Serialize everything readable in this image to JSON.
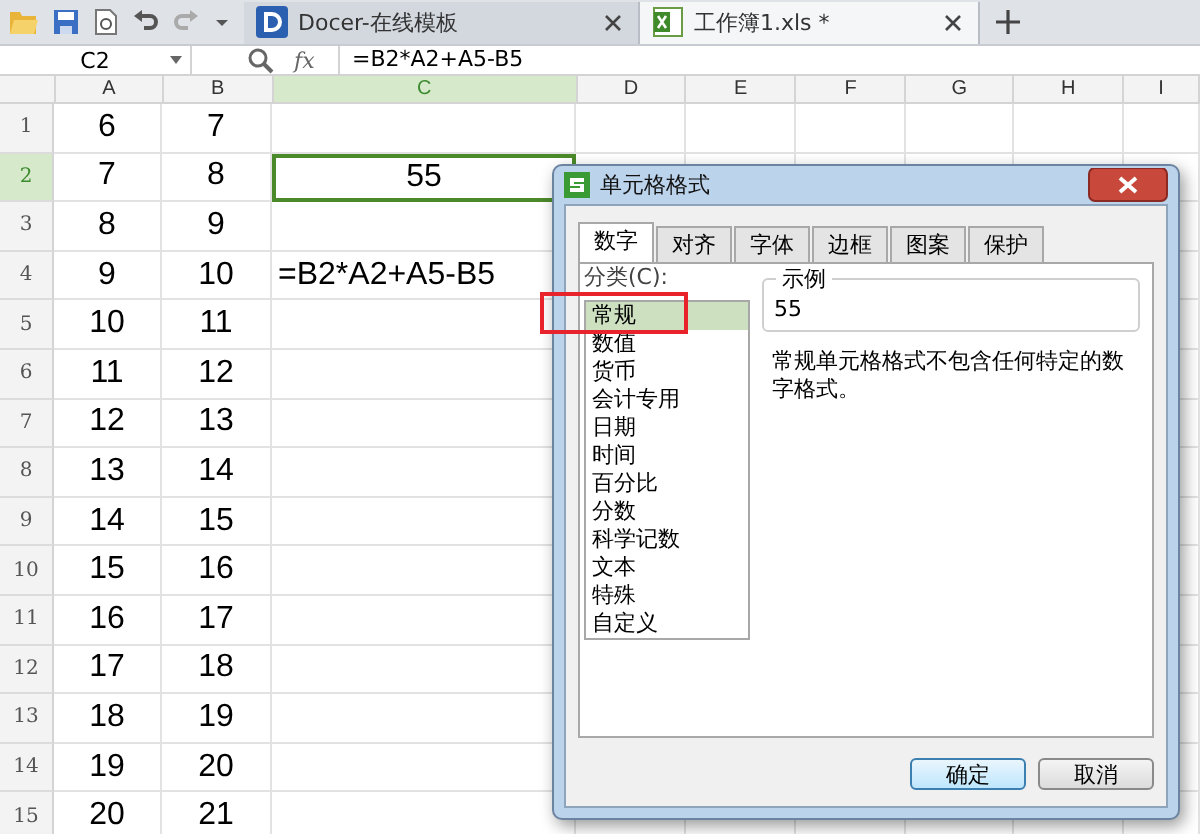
{
  "tabs": [
    {
      "label": "Docer-在线模板",
      "kind": "docer",
      "selected": false
    },
    {
      "label": "工作簿1.xls *",
      "kind": "sheet",
      "selected": true
    }
  ],
  "formula_bar": {
    "name_box": "C2",
    "fx": "fx",
    "formula": "=B2*A2+A5-B5"
  },
  "columns": [
    {
      "label": "A",
      "selected": false
    },
    {
      "label": "B",
      "selected": false
    },
    {
      "label": "C",
      "selected": true
    },
    {
      "label": "D",
      "selected": false
    },
    {
      "label": "E",
      "selected": false
    },
    {
      "label": "F",
      "selected": false
    },
    {
      "label": "G",
      "selected": false
    },
    {
      "label": "H",
      "selected": false
    },
    {
      "label": "I",
      "selected": false
    }
  ],
  "rows": [
    {
      "number": "1",
      "selected": false,
      "cells": [
        "6",
        "7",
        ""
      ]
    },
    {
      "number": "2",
      "selected": true,
      "cells": [
        "7",
        "8",
        "55"
      ]
    },
    {
      "number": "3",
      "selected": false,
      "cells": [
        "8",
        "9",
        ""
      ]
    },
    {
      "number": "4",
      "selected": false,
      "cells": [
        "9",
        "10",
        "=B2*A2+A5-B5"
      ]
    },
    {
      "number": "5",
      "selected": false,
      "cells": [
        "10",
        "11",
        ""
      ]
    },
    {
      "number": "6",
      "selected": false,
      "cells": [
        "11",
        "12",
        ""
      ]
    },
    {
      "number": "7",
      "selected": false,
      "cells": [
        "12",
        "13",
        ""
      ]
    },
    {
      "number": "8",
      "selected": false,
      "cells": [
        "13",
        "14",
        ""
      ]
    },
    {
      "number": "9",
      "selected": false,
      "cells": [
        "14",
        "15",
        ""
      ]
    },
    {
      "number": "10",
      "selected": false,
      "cells": [
        "15",
        "16",
        ""
      ]
    },
    {
      "number": "11",
      "selected": false,
      "cells": [
        "16",
        "17",
        ""
      ]
    },
    {
      "number": "12",
      "selected": false,
      "cells": [
        "17",
        "18",
        ""
      ]
    },
    {
      "number": "13",
      "selected": false,
      "cells": [
        "18",
        "19",
        ""
      ]
    },
    {
      "number": "14",
      "selected": false,
      "cells": [
        "19",
        "20",
        ""
      ]
    },
    {
      "number": "15",
      "selected": false,
      "cells": [
        "20",
        "21",
        ""
      ]
    }
  ],
  "dialog": {
    "title": "单元格格式",
    "tabs": [
      {
        "label": "数字",
        "selected": true
      },
      {
        "label": "对齐",
        "selected": false
      },
      {
        "label": "字体",
        "selected": false
      },
      {
        "label": "边框",
        "selected": false
      },
      {
        "label": "图案",
        "selected": false
      },
      {
        "label": "保护",
        "selected": false
      }
    ],
    "category_label": "分类(C):",
    "categories": [
      {
        "label": "常规",
        "selected": true
      },
      {
        "label": "数值",
        "selected": false
      },
      {
        "label": "货币",
        "selected": false
      },
      {
        "label": "会计专用",
        "selected": false
      },
      {
        "label": "日期",
        "selected": false
      },
      {
        "label": "时间",
        "selected": false
      },
      {
        "label": "百分比",
        "selected": false
      },
      {
        "label": "分数",
        "selected": false
      },
      {
        "label": "科学记数",
        "selected": false
      },
      {
        "label": "文本",
        "selected": false
      },
      {
        "label": "特殊",
        "selected": false
      },
      {
        "label": "自定义",
        "selected": false
      }
    ],
    "sample_label": "示例",
    "sample_value": "55",
    "description": "常规单元格格式不包含任何特定的数字格式。",
    "buttons": [
      {
        "label": "确定",
        "kind": "primary"
      },
      {
        "label": "取消",
        "kind": "normal"
      }
    ]
  }
}
